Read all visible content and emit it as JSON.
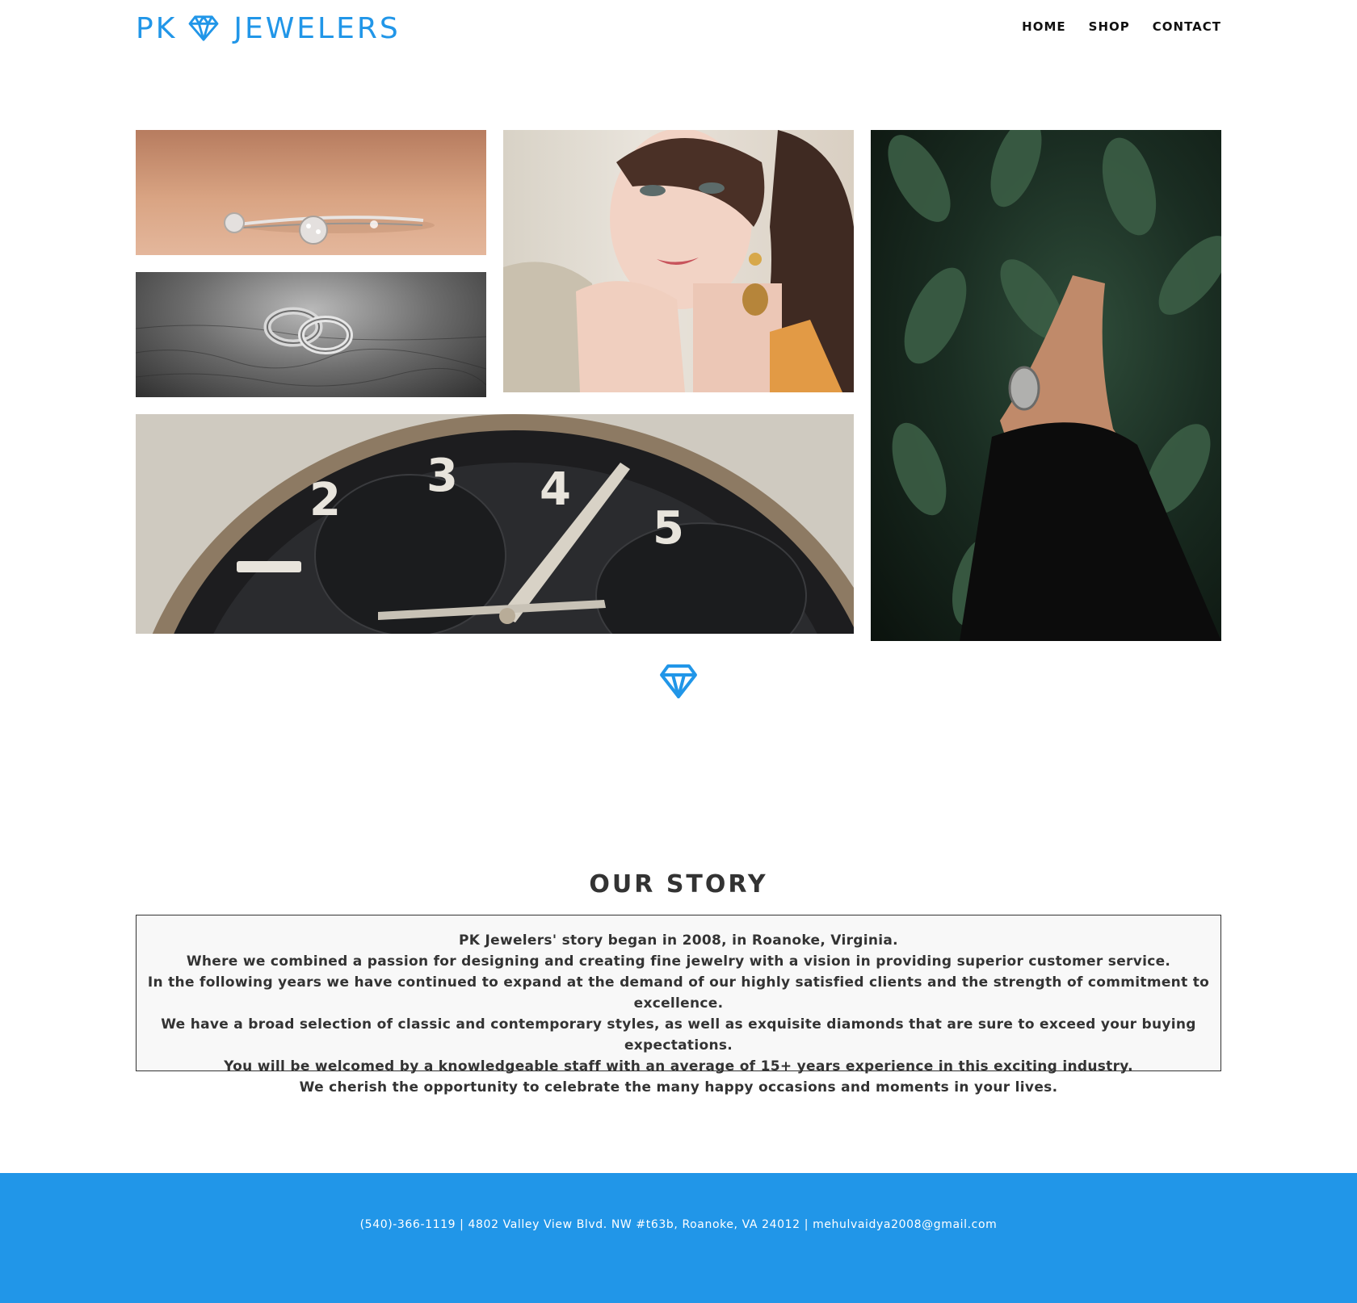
{
  "brand": {
    "name_left": "PK",
    "name_right": "JEWELERS",
    "accent_color": "#2196e8",
    "logo_icon": "diamond-icon"
  },
  "nav": {
    "items": [
      {
        "label": "HOME"
      },
      {
        "label": "SHOP"
      },
      {
        "label": "CONTACT"
      }
    ]
  },
  "gallery": {
    "images": [
      {
        "name": "bracelet-photo"
      },
      {
        "name": "wedding-rings-photo"
      },
      {
        "name": "model-earrings-photo"
      },
      {
        "name": "hand-ring-plants-photo"
      },
      {
        "name": "watch-dial-photo"
      }
    ]
  },
  "story": {
    "title": "OUR STORY",
    "lines": [
      "PK Jewelers' story began in 2008, in Roanoke, Virginia.",
      "Where we combined a passion for designing and creating fine jewelry with a vision in providing superior customer service.",
      "In the following years we have continued to expand at the demand of our highly satisfied clients and the strength of commitment to excellence.",
      "We have a broad selection of classic and contemporary styles, as well as exquisite diamonds that are sure to exceed your buying expectations.",
      "You will be welcomed by a knowledgeable staff with an average of 15+ years experience in this exciting industry.",
      "We cherish the opportunity to celebrate the many happy occasions and moments in your lives."
    ]
  },
  "footer": {
    "contact": "(540)-366-1119 | 4802 Valley View Blvd. NW #t63b, Roanoke, VA 24012 | mehulvaidya2008@gmail.com",
    "background_color": "#2196e8"
  }
}
